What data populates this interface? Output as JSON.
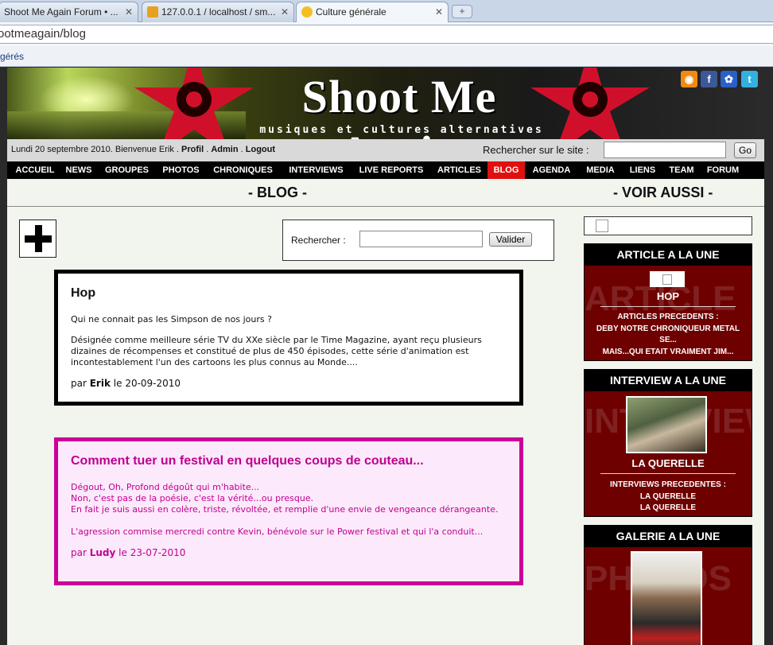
{
  "browser": {
    "tabs": [
      {
        "label": "Shoot Me Again Forum • ..."
      },
      {
        "label": "127.0.0.1 / localhost / sm..."
      },
      {
        "label": "Culture générale"
      }
    ],
    "new_tab": "+",
    "url": "ootmeagain/blog",
    "bookmarks_label": "gérés"
  },
  "banner": {
    "logo_line": "Shoot Me Again",
    "tagline": "musiques et cultures alternatives"
  },
  "infobar": {
    "greeting": "Lundi 20 septembre 2010. Bienvenue Erik .",
    "profile_link": "Profil",
    "admin_link": "Admin",
    "logout_link": "Logout",
    "search_label": "Rechercher sur le site :",
    "search_value": "",
    "go_label": "Go"
  },
  "nav": {
    "items": [
      {
        "label": "ACCUEIL"
      },
      {
        "label": "NEWS"
      },
      {
        "label": "GROUPES"
      },
      {
        "label": "PHOTOS"
      },
      {
        "label": "CHRONIQUES"
      },
      {
        "label": "INTERVIEWS"
      },
      {
        "label": "LIVE REPORTS"
      },
      {
        "label": "ARTICLES"
      },
      {
        "label": "BLOG"
      },
      {
        "label": "AGENDA"
      },
      {
        "label": "MEDIA"
      },
      {
        "label": "LIENS"
      },
      {
        "label": "TEAM"
      },
      {
        "label": "FORUM"
      }
    ],
    "active": "BLOG",
    "active_color": "#e01010"
  },
  "main": {
    "blog_heading": "- BLOG -",
    "see_also_heading": "- VOIR AUSSI -",
    "search_label": "Rechercher :",
    "search_value": "",
    "submit_label": "Valider"
  },
  "posts": [
    {
      "title": "Hop",
      "paragraphs": [
        "Qui ne connait pas les Simpson de nos jours ?",
        "Désignée comme meilleure série TV du XXe siècle par le Time Magazine, ayant reçu plusieurs dizaines de récompenses et constitué de plus de 450 épisodes, cette série d'animation est incontestablement l'un des cartoons les plus connus au Monde...."
      ],
      "by": "par",
      "author": "Erik",
      "date": "le 20-09-2010",
      "border_color": "#000000"
    },
    {
      "title": "Comment tuer un festival en quelques coups de couteau...",
      "paragraphs": [
        "Dégout, Oh, Profond dégoût qui m'habite...",
        "Non, c'est pas de la poésie, c'est la vérité...ou presque.",
        "En fait je suis aussi en colère, triste, révoltée, et remplie d'une envie de vengeance dérangeante.",
        "L'agression commise mercredi contre Kevin, bénévole sur le Power festival et qui l'a conduit..."
      ],
      "by": "par",
      "author": "Ludy",
      "date": "le 23-07-2010",
      "border_color": "#cc0099"
    }
  ],
  "sidebar": {
    "article": {
      "header": "ARTICLE A LA UNE",
      "watermark": "ARTICLE",
      "title": "HOP",
      "previous_label": "ARTICLES PRECEDENTS :",
      "previous": [
        "DEBY NOTRE CHRONIQUEUR METAL",
        "SE...",
        "MAIS...QUI ETAIT VRAIMENT JIM..."
      ]
    },
    "interview": {
      "header": "INTERVIEW A LA UNE",
      "watermark": "INTERVIEW",
      "title": "LA QUERELLE",
      "previous_label": "INTERVIEWS PRECEDENTES :",
      "previous": [
        "LA QUERELLE",
        "LA QUERELLE"
      ]
    },
    "gallery": {
      "header": "GALERIE A LA UNE",
      "watermark": "PHOTOS"
    }
  },
  "colors": {
    "panel_red": "#6e0000",
    "post2_bg": "#fde9fc",
    "post2_text": "#c0008f"
  }
}
